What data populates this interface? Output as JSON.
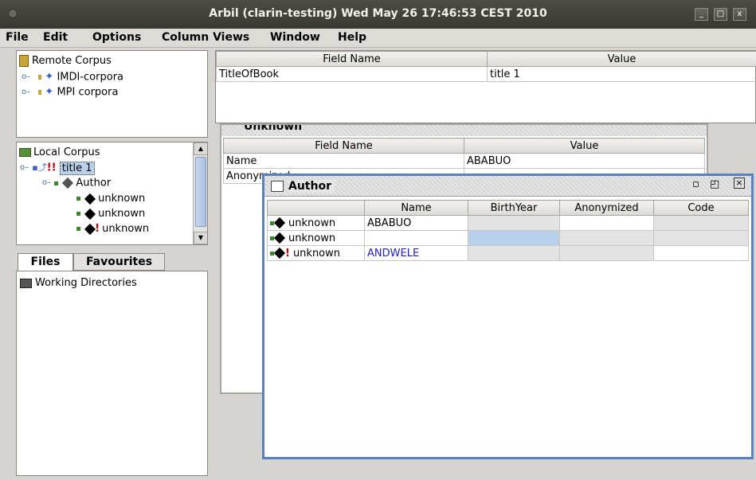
{
  "window": {
    "title": "Arbil (clarin-testing) Wed May 26 17:46:53 CEST 2010",
    "controls": [
      "_",
      "□",
      "x"
    ]
  },
  "menu": [
    "File",
    "Edit",
    "Options",
    "Column Views",
    "Window",
    "Help"
  ],
  "remote_tree": {
    "root": "Remote Corpus",
    "items": [
      "IMDI-corpora",
      "MPI corpora"
    ]
  },
  "local_tree": {
    "root": "Local Corpus",
    "items": [
      "title 1",
      "Author",
      "unknown",
      "unknown",
      "unknown"
    ]
  },
  "bottom_tabs": {
    "tabs": [
      "Files",
      "Favourites"
    ],
    "items": [
      "Working Directories"
    ]
  },
  "top_table": {
    "headers": [
      "Field Name",
      "Value"
    ],
    "rows": [
      [
        "TitleOfBook",
        "title 1"
      ]
    ]
  },
  "unknown_frame": {
    "title": "Unknown",
    "headers": [
      "Field Name",
      "Value"
    ],
    "rows": [
      [
        "Name",
        "ABABUO"
      ],
      [
        "Anonymized",
        ""
      ]
    ]
  },
  "author_frame": {
    "title": "Author",
    "headers": [
      "",
      "Name",
      "BirthYear",
      "Anonymized",
      "Code"
    ],
    "rows": [
      [
        "unknown",
        "ABABUO",
        "",
        "",
        ""
      ],
      [
        "unknown",
        "",
        "",
        "",
        ""
      ],
      [
        "unknown",
        "ANDWELE",
        "",
        "",
        ""
      ]
    ]
  },
  "colors": {
    "frame_border": "#5682c4",
    "link_text": "#2020d0",
    "selection": "#b8d0ea",
    "error_mark": "#c40000"
  }
}
